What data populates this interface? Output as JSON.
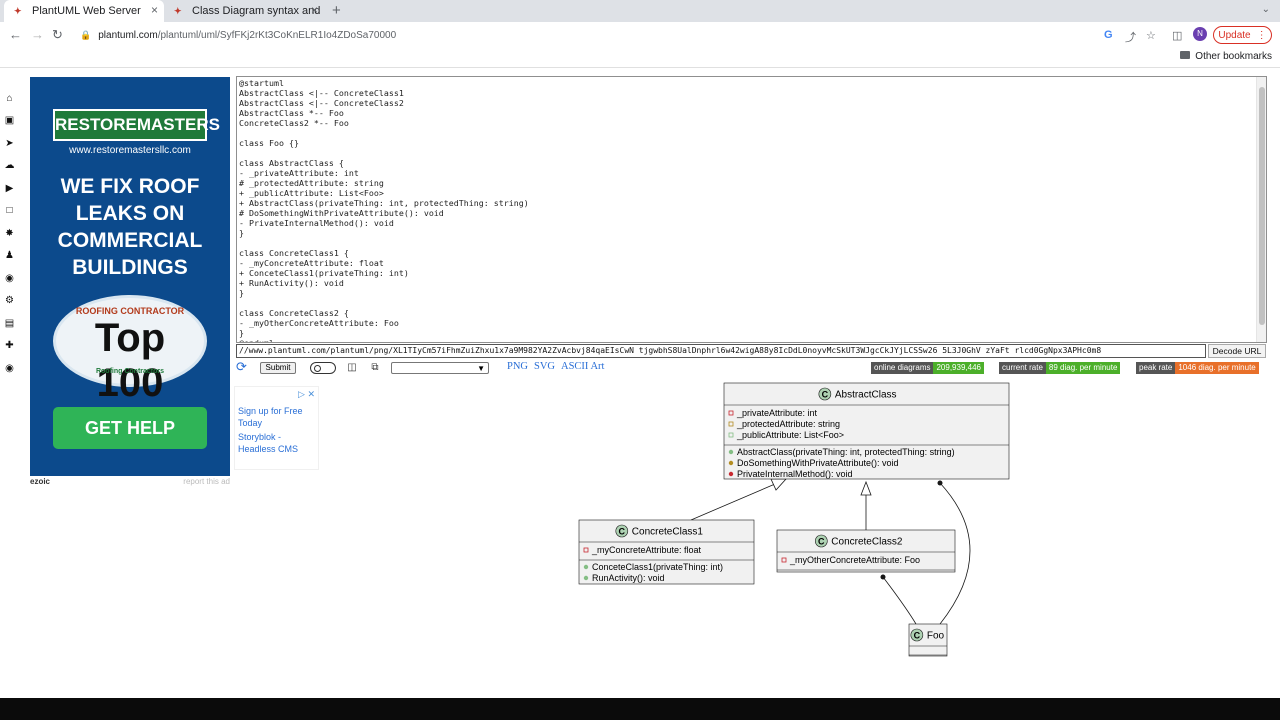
{
  "browser": {
    "tabs": [
      {
        "label": "PlantUML Web Server",
        "active": true
      },
      {
        "label": "Class Diagram syntax and ",
        "active": false
      }
    ],
    "url_host": "plantuml.com",
    "url_path": "/plantuml/uml/SyfFKj2rKt3CoKnELR1Io4ZDoSa70000",
    "avatar_letter": "N",
    "update_label": "Update",
    "other_bookmarks": "Other bookmarks"
  },
  "ad": {
    "brand": "RESTOREMASTERS",
    "url": "www.restoremastersllc.com",
    "headline_lines": [
      "WE FIX ROOF",
      "LEAKS ON",
      "COMMERCIAL",
      "BUILDINGS"
    ],
    "badge_top": "ROOFING CONTRACTOR",
    "badge_number": "Top 100",
    "badge_bottom": "Roofing Contractors",
    "cta": "GET HELP",
    "footer_brand": "ezoic",
    "footer_report": "report this ad"
  },
  "ad2": {
    "link1": "Sign up for Free Today",
    "link2": "Storyblok - Headless CMS"
  },
  "editor": {
    "source": "@startuml\nAbstractClass <|-- ConcreteClass1\nAbstractClass <|-- ConcreteClass2\nAbstractClass *-- Foo\nConcreteClass2 *-- Foo\n\nclass Foo {}\n\nclass AbstractClass {\n- _privateAttribute: int\n# _protectedAttribute: string\n+ _publicAttribute: List<Foo>\n+ AbstractClass(privateThing: int, protectedThing: string)\n# DoSomethingWithPrivateAttribute(): void\n- PrivateInternalMethod(): void\n}\n\nclass ConcreteClass1 {\n- _myConcreteAttribute: float\n+ ConceteClass1(privateThing: int)\n+ RunActivity(): void\n}\n\nclass ConcreteClass2 {\n- _myOtherConcreteAttribute: Foo\n}\n@enduml"
  },
  "url_field": "//www.plantuml.com/plantuml/png/XL1TIyCm57iFhmZuiZhxu1x7a9M982YA2ZvAcbvj84qaEIsCwN tjgwbhS8UalDnphrl6w42wigA88y8IcDdL0noyvMcSkUT3WJgcCkJYjLCSSw26  5L3J0GhV zYaFt rlcd0GgNpx3APHc0m8",
  "decode_label": "Decode URL",
  "submit_label": "Submit",
  "formats": [
    "PNG",
    "SVG",
    "ASCII Art"
  ],
  "stats": [
    {
      "label": "online diagrams",
      "value": "209,939,446",
      "color": "#4caf2a"
    },
    {
      "label": "current rate",
      "value": "89 diag. per minute",
      "color": "#4caf2a"
    },
    {
      "label": "peak rate",
      "value": "1046 diag. per minute",
      "color": "#e8702a"
    }
  ],
  "diagram": {
    "classes": [
      {
        "name": "AbstractClass",
        "attributes": [
          {
            "vis": "private",
            "text": "_privateAttribute: int"
          },
          {
            "vis": "protected",
            "text": "_protectedAttribute: string"
          },
          {
            "vis": "public",
            "text": "_publicAttribute: List<Foo>"
          }
        ],
        "methods": [
          {
            "vis": "public",
            "text": "AbstractClass(privateThing: int, protectedThing: string)"
          },
          {
            "vis": "protected",
            "text": "DoSomethingWithPrivateAttribute(): void"
          },
          {
            "vis": "private",
            "text": "PrivateInternalMethod(): void"
          }
        ]
      },
      {
        "name": "ConcreteClass1",
        "attributes": [
          {
            "vis": "private",
            "text": "_myConcreteAttribute: float"
          }
        ],
        "methods": [
          {
            "vis": "public",
            "text": "ConceteClass1(privateThing: int)"
          },
          {
            "vis": "public",
            "text": "RunActivity(): void"
          }
        ]
      },
      {
        "name": "ConcreteClass2",
        "attributes": [
          {
            "vis": "private",
            "text": "_myOtherConcreteAttribute: Foo"
          }
        ],
        "methods": []
      },
      {
        "name": "Foo",
        "attributes": [],
        "methods": []
      }
    ],
    "class_letter": "C",
    "colors": {
      "box": "#f1f1f1",
      "border": "#181818",
      "icon": "#add1b2",
      "private": "#c82930",
      "protected": "#b38d22",
      "public": "#84be84"
    }
  }
}
